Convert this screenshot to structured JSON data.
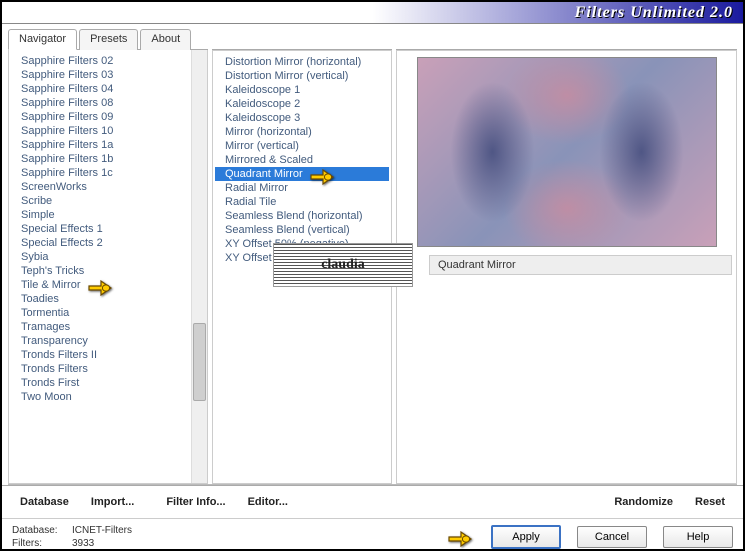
{
  "title": "Filters Unlimited 2.0",
  "tabs": [
    "Navigator",
    "Presets",
    "About"
  ],
  "active_tab": 0,
  "categories": [
    "Sapphire Filters 02",
    "Sapphire Filters 03",
    "Sapphire Filters 04",
    "Sapphire Filters 08",
    "Sapphire Filters 09",
    "Sapphire Filters 10",
    "Sapphire Filters 1a",
    "Sapphire Filters 1b",
    "Sapphire Filters 1c",
    "ScreenWorks",
    "Scribe",
    "Simple",
    "Special Effects 1",
    "Special Effects 2",
    "Sybia",
    "Teph's Tricks",
    "Tile & Mirror",
    "Toadies",
    "Tormentia",
    "Tramages",
    "Transparency",
    "Tronds Filters II",
    "Tronds Filters",
    "Tronds First",
    "Two Moon"
  ],
  "selected_category_index": 16,
  "filters": [
    "Distortion Mirror (horizontal)",
    "Distortion Mirror (vertical)",
    "Kaleidoscope 1",
    "Kaleidoscope 2",
    "Kaleidoscope 3",
    "Mirror (horizontal)",
    "Mirror (vertical)",
    "Mirrored & Scaled",
    "Quadrant Mirror",
    "Radial Mirror",
    "Radial Tile",
    "Seamless Blend (horizontal)",
    "Seamless Blend (vertical)",
    "XY Offset 50% (negative)",
    "XY Offset 50% (positive)"
  ],
  "selected_filter_index": 8,
  "watermark": "claudia",
  "selected_filter_label": "Quadrant Mirror",
  "toolbar": {
    "database": "Database",
    "import": "Import...",
    "filter_info": "Filter Info...",
    "editor": "Editor...",
    "randomize": "Randomize",
    "reset": "Reset"
  },
  "status": {
    "db_label": "Database:",
    "db_value": "ICNET-Filters",
    "filters_label": "Filters:",
    "filters_value": "3933"
  },
  "buttons": {
    "apply": "Apply",
    "cancel": "Cancel",
    "help": "Help"
  }
}
